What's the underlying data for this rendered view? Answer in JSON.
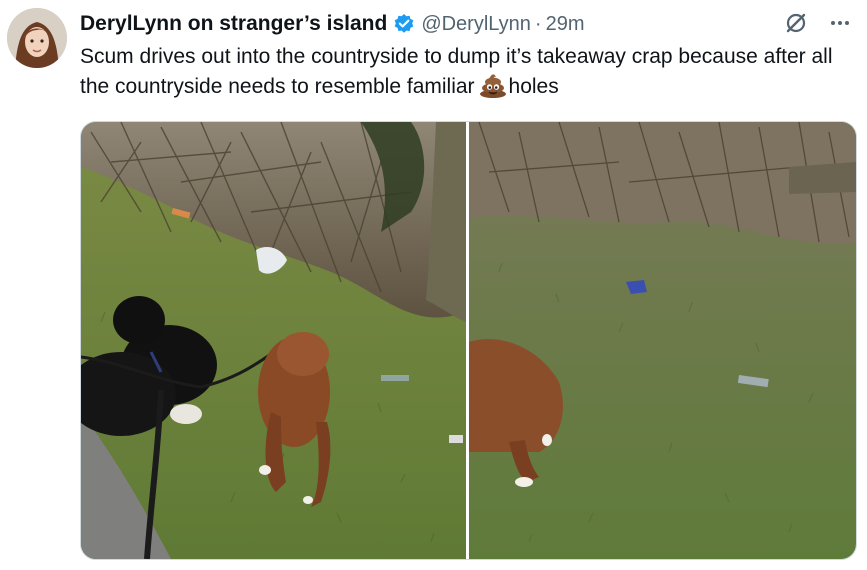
{
  "tweet": {
    "display_name": "DerylLynn on stranger’s island",
    "handle": "@DerylLynn",
    "separator": "·",
    "time": "29m",
    "text_before_emoji": "Scum drives out into the countryside to dump it’s takeaway crap because after all the countryside needs to resemble familiar",
    "text_after_emoji": "holes",
    "emoji": "pile-of-poo"
  },
  "icons": {
    "verified": "verified-badge-icon",
    "grok": "grok-icon",
    "more": "more-icon"
  },
  "colors": {
    "verified_blue": "#1d9bf0",
    "text": "#0f1419",
    "secondary": "#536471"
  },
  "media": {
    "count": 2,
    "photos": [
      "photo-dogs-by-hedge",
      "photo-dog-on-grass"
    ]
  }
}
